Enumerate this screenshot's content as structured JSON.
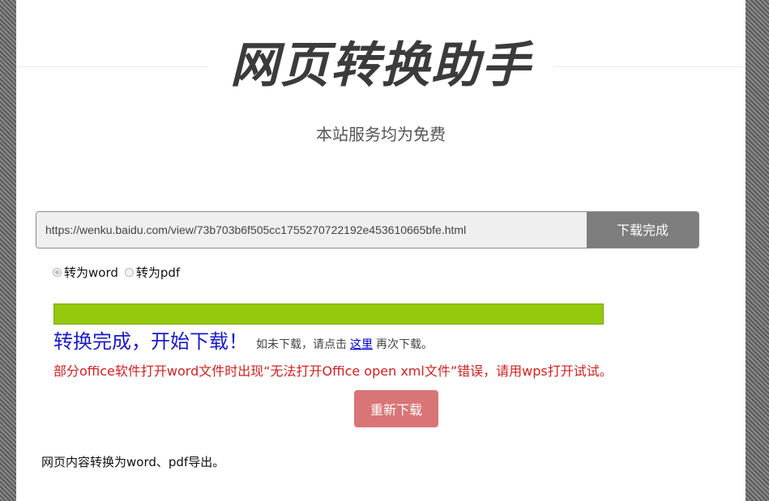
{
  "header": {
    "title": "网页转换助手",
    "subtitle": "本站服务均为免费"
  },
  "url_form": {
    "value": "https://wenku.baidu.com/view/73b703b6f505cc1755270722192e453610665bfe.html",
    "button_label": "下载完成"
  },
  "format_options": [
    {
      "label": "转为word",
      "checked": true
    },
    {
      "label": "转为pdf",
      "checked": false
    }
  ],
  "progress": {
    "percent": 100,
    "fill_color": "#94c90c"
  },
  "status": {
    "done_text": "转换完成，开始下载！",
    "hint_prefix": "如未下载，请点击",
    "hint_link": "这里",
    "hint_suffix": "再次下载。",
    "warning": "部分office软件打开word文件时出现“无法打开Office open xml文件”错误，请用wps打开试试。"
  },
  "redownload_label": "重新下载",
  "footer_text": "网页内容转换为word、pdf导出。",
  "colors": {
    "accent_blue": "#1a1acc",
    "warning_red": "#d02020",
    "redownload_bg": "#d97576",
    "url_button_bg": "#7d7d7d"
  }
}
